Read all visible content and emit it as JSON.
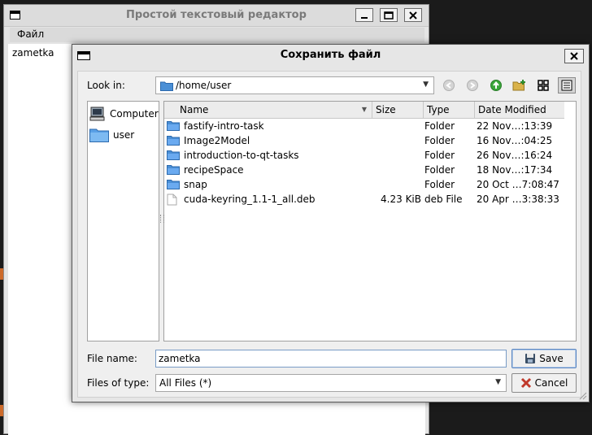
{
  "editor_window": {
    "title": "Простой текстовый редактор",
    "menu": [
      {
        "label": "Файл"
      }
    ],
    "text_content": "zametka"
  },
  "dialog": {
    "title": "Сохранить файл",
    "look_in_label": "Look in:",
    "look_in_path": "/home/user",
    "toolbar_icons": [
      "back-arrow-icon",
      "forward-arrow-icon",
      "parent-dir-icon",
      "new-folder-icon",
      "list-view-icon",
      "detail-view-icon"
    ],
    "sidebar": [
      {
        "label": "Computer",
        "icon": "computer-icon"
      },
      {
        "label": "user",
        "icon": "folder-icon"
      }
    ],
    "columns": [
      "Name",
      "Size",
      "Type",
      "Date Modified"
    ],
    "files": [
      {
        "name": "fastify-intro-task",
        "size": "",
        "type": "Folder",
        "date": "22 Nov…:13:39",
        "icon": "folder-icon"
      },
      {
        "name": "Image2Model",
        "size": "",
        "type": "Folder",
        "date": "16 Nov…:04:25",
        "icon": "folder-icon"
      },
      {
        "name": "introduction-to-qt-tasks",
        "size": "",
        "type": "Folder",
        "date": "26 Nov…:16:24",
        "icon": "folder-icon"
      },
      {
        "name": "recipeSpace",
        "size": "",
        "type": "Folder",
        "date": "18 Nov…:17:34",
        "icon": "folder-icon"
      },
      {
        "name": "snap",
        "size": "",
        "type": "Folder",
        "date": "20 Oct …7:08:47",
        "icon": "folder-icon"
      },
      {
        "name": "cuda-keyring_1.1-1_all.deb",
        "size": "4.23 KiB",
        "type": "deb File",
        "date": "20 Apr …3:38:33",
        "icon": "file-icon"
      }
    ],
    "file_name_label": "File name:",
    "file_name_value": "zametka",
    "files_of_type_label": "Files of type:",
    "files_of_type_value": "All Files (*)",
    "save_label": "Save",
    "cancel_label": "Cancel"
  }
}
